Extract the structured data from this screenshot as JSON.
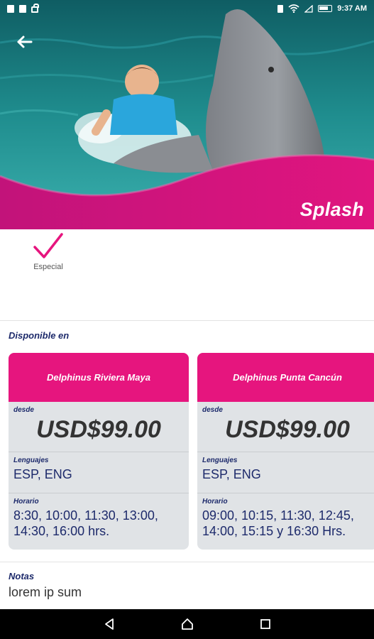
{
  "status_bar": {
    "time": "9:37 AM"
  },
  "hero": {
    "title": "Splash",
    "accent_color": "#e6157e"
  },
  "feature": {
    "label": "Especial",
    "icon": "check-icon"
  },
  "available": {
    "heading": "Disponible en",
    "locations": [
      {
        "name": "Delphinus Riviera Maya",
        "price_label": "desde",
        "price": "USD$99.00",
        "languages_label": "Lenguajes",
        "languages": "ESP, ENG",
        "hours_label": "Horario",
        "hours_line1": "8:30, 10:00, 11:30, 13:00,",
        "hours_line2": "14:30, 16:00 hrs."
      },
      {
        "name": "Delphinus Punta Cancún",
        "price_label": "desde",
        "price": "USD$99.00",
        "languages_label": "Lenguajes",
        "languages": "ESP, ENG",
        "hours_label": "Horario",
        "hours_line1": "09:00, 10:15, 11:30, 12:45,",
        "hours_line2": "14:00, 15:15 y 16:30 Hrs."
      }
    ]
  },
  "notes": {
    "heading": "Notas",
    "text": "lorem ip sum"
  },
  "colors": {
    "primary": "#e6157e",
    "navy": "#1d2a6b",
    "card_bg": "#e0e3e6"
  }
}
